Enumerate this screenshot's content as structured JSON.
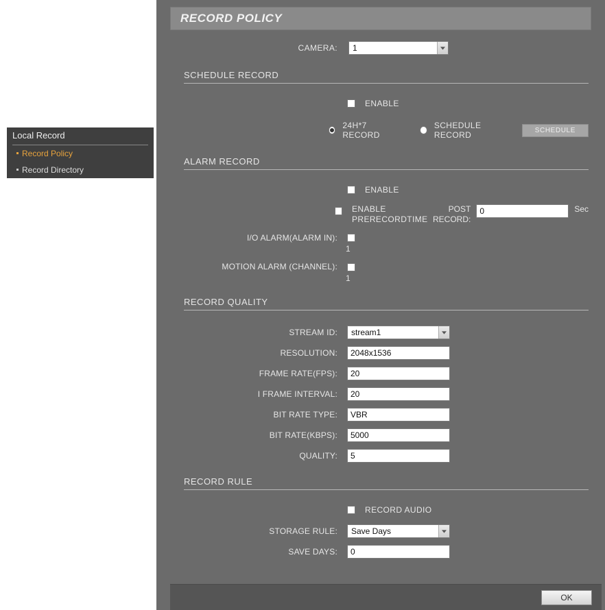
{
  "sidebar": {
    "title": "Local Record",
    "items": [
      {
        "label": "Record Policy",
        "active": true
      },
      {
        "label": "Record Directory",
        "active": false
      }
    ]
  },
  "page_title": "RECORD POLICY",
  "camera": {
    "label": "CAMERA:",
    "value": "1"
  },
  "schedule_record": {
    "title": "SCHEDULE RECORD",
    "enable": "ENABLE",
    "r1": "24H*7 RECORD",
    "r2": "SCHEDULE RECORD",
    "schedule_btn": "SCHEDULE"
  },
  "alarm_record": {
    "title": "ALARM RECORD",
    "enable": "ENABLE",
    "enable_prerec": "ENABLE PRERECORDTIME",
    "post_record": "POST RECORD:",
    "post_value": "0",
    "post_unit": "Sec",
    "io_alarm": "I/O ALARM(ALARM IN):",
    "io_sub": "1",
    "motion": "MOTION ALARM (CHANNEL):",
    "motion_sub": "1"
  },
  "record_quality": {
    "title": "RECORD QUALITY",
    "stream_id": {
      "label": "STREAM ID:",
      "value": "stream1"
    },
    "resolution": {
      "label": "RESOLUTION:",
      "value": "2048x1536"
    },
    "frame_rate": {
      "label": "FRAME RATE(FPS):",
      "value": "20"
    },
    "iframe": {
      "label": "I FRAME INTERVAL:",
      "value": "20"
    },
    "br_type": {
      "label": "BIT RATE TYPE:",
      "value": "VBR"
    },
    "br_kbps": {
      "label": "BIT RATE(KBPS):",
      "value": "5000"
    },
    "quality": {
      "label": "QUALITY:",
      "value": "5"
    }
  },
  "record_rule": {
    "title": "RECORD RULE",
    "record_audio": "RECORD AUDIO",
    "storage_rule": {
      "label": "STORAGE RULE:",
      "value": "Save Days"
    },
    "save_days": {
      "label": "SAVE DAYS:",
      "value": "0"
    }
  },
  "ok": "OK"
}
